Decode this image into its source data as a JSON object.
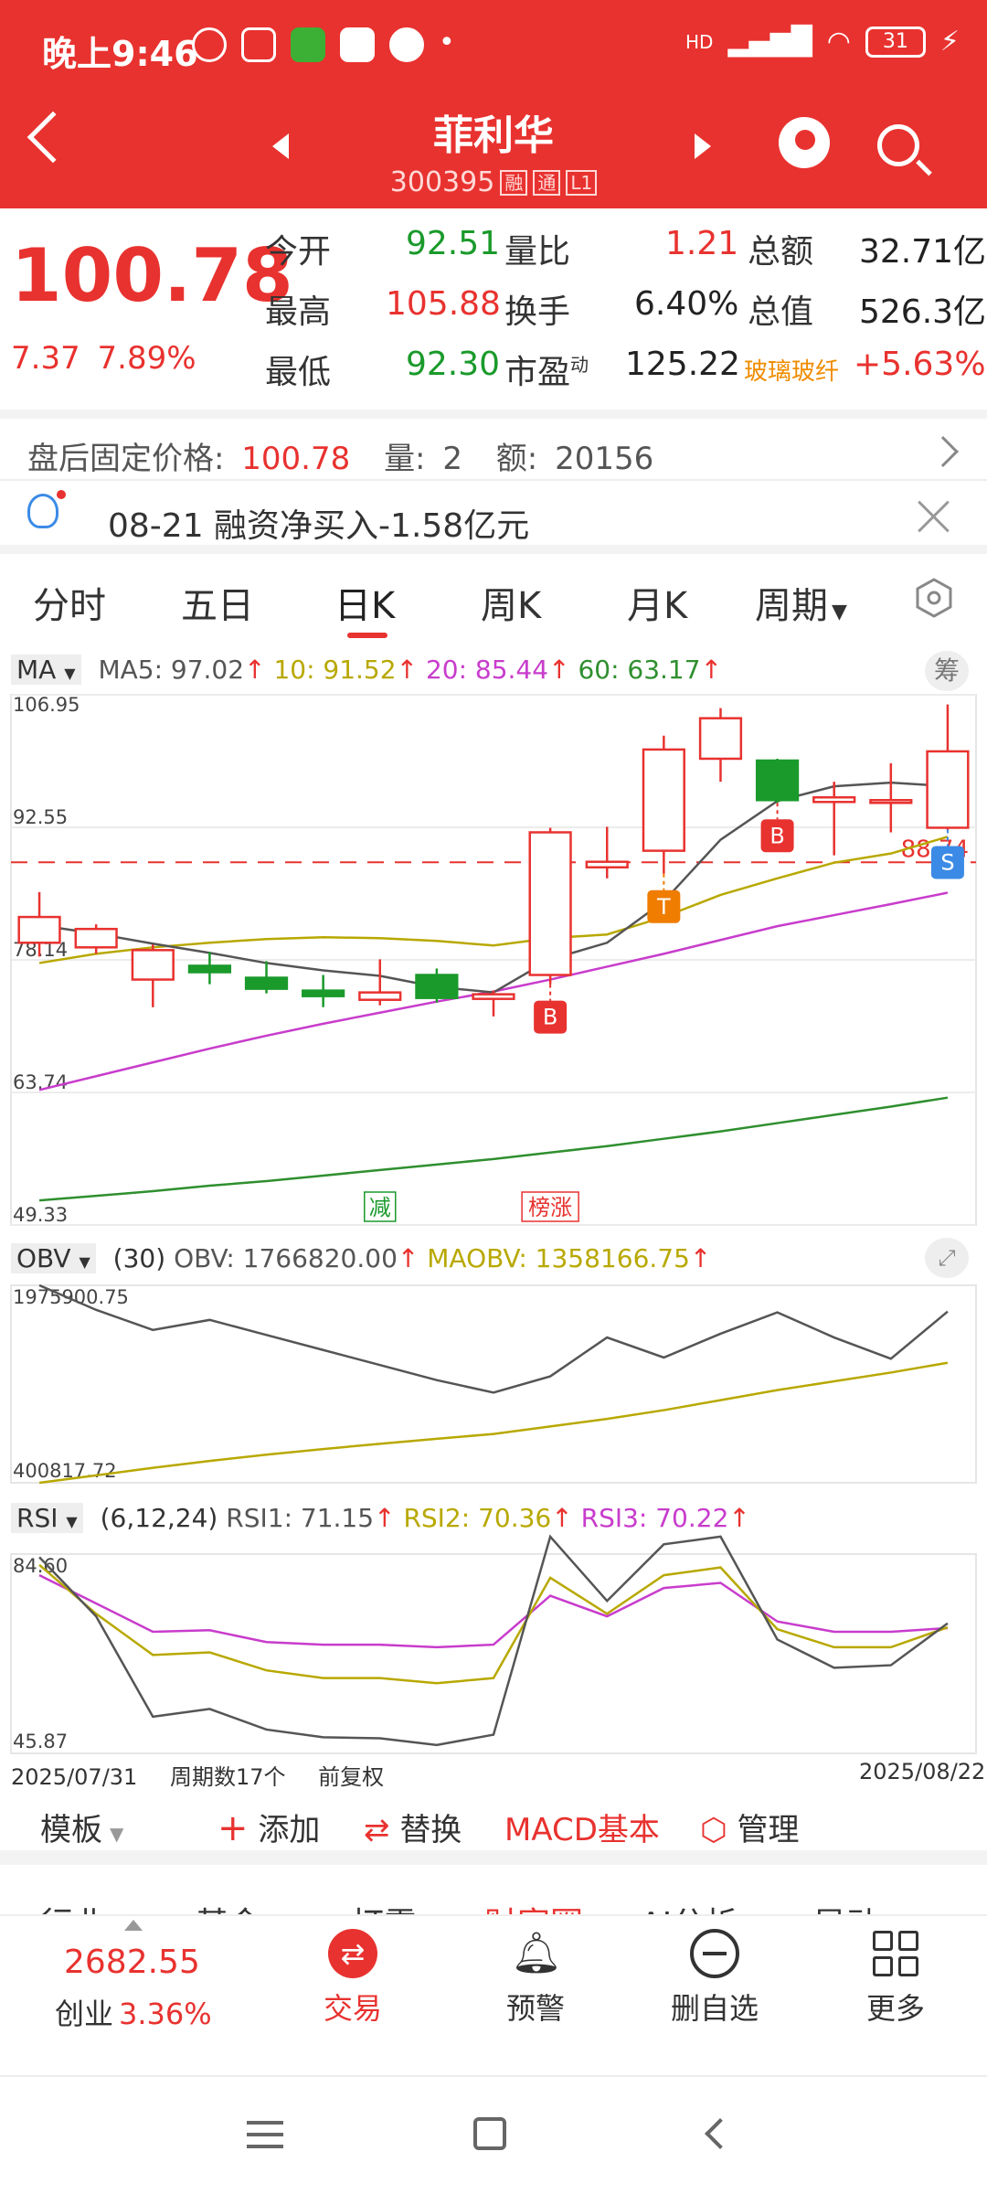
{
  "status_bar": {
    "time": "晚上9:46",
    "network": "HD",
    "battery": "31"
  },
  "header": {
    "stock_name": "菲利华",
    "stock_code": "300395",
    "tags": [
      "融",
      "通",
      "L1"
    ]
  },
  "quote": {
    "price": "100.78",
    "change": "7.37",
    "change_pct": "7.89%",
    "fields": [
      {
        "label": "今开",
        "value": "92.51",
        "color": "#1a9a2b"
      },
      {
        "label": "量比",
        "value": "1.21",
        "color": "#e8322f"
      },
      {
        "label": "总额",
        "value": "32.71亿",
        "color": "#222222"
      },
      {
        "label": "最高",
        "value": "105.88",
        "color": "#e8322f"
      },
      {
        "label": "换手",
        "value": "6.40%",
        "color": "#222222"
      },
      {
        "label": "总值",
        "value": "526.3亿",
        "color": "#222222"
      },
      {
        "label": "最低",
        "value": "92.30",
        "color": "#1a9a2b"
      },
      {
        "label": "市盈",
        "value": "125.22",
        "color": "#222222"
      }
    ],
    "pe_superscript": "动",
    "sector_name": "玻璃玻纤",
    "sector_change": "+5.63%"
  },
  "after_hours": {
    "label": "盘后固定价格:",
    "price": "100.78",
    "vol_label": "量:",
    "vol": "2",
    "amt_label": "额:",
    "amt": "20156"
  },
  "notice": {
    "text": "08-21 融资净买入-1.58亿元"
  },
  "tabs": [
    "分时",
    "五日",
    "日K",
    "周K",
    "月K",
    "周期"
  ],
  "active_tab": "日K",
  "colors": {
    "up": "#e8322f",
    "down": "#1a9a2b",
    "ma5": "#555555",
    "ma10": "#b8a800",
    "ma20": "#c83ccc",
    "ma60": "#2f8f2f"
  },
  "ma_indicator": {
    "name": "MA",
    "ma5": "MA5: 97.02",
    "ma10": "10: 91.52",
    "ma20": "20: 85.44",
    "ma60": "60: 63.17",
    "chip_btn": "筹"
  },
  "obv_indicator": {
    "name": "OBV",
    "param": "(30)",
    "obv": "OBV: 1766820.00",
    "maobv": "MAOBV: 1358166.75"
  },
  "rsi_indicator": {
    "name": "RSI",
    "param": "(6,12,24)",
    "rsi1": "RSI1: 71.15",
    "rsi2": "RSI2: 70.36",
    "rsi3": "RSI3: 70.22"
  },
  "chart_data": [
    {
      "type": "candlestick",
      "ylim": [
        49.33,
        106.95
      ],
      "y_ticks": [
        "106.95",
        "92.55",
        "78.14",
        "63.74",
        "49.33"
      ],
      "reference_line": "88.74",
      "candles": [
        {
          "o": 80.0,
          "h": 85.5,
          "l": 78.5,
          "c": 82.8
        },
        {
          "o": 79.5,
          "h": 82.0,
          "l": 78.8,
          "c": 81.5
        },
        {
          "o": 76.0,
          "h": 79.8,
          "l": 73.0,
          "c": 79.2
        },
        {
          "o": 77.5,
          "h": 79.0,
          "l": 75.5,
          "c": 76.8
        },
        {
          "o": 76.2,
          "h": 78.0,
          "l": 74.5,
          "c": 75.0
        },
        {
          "o": 74.8,
          "h": 76.5,
          "l": 73.0,
          "c": 74.2
        },
        {
          "o": 73.8,
          "h": 78.2,
          "l": 73.2,
          "c": 74.6
        },
        {
          "o": 76.5,
          "h": 77.2,
          "l": 73.5,
          "c": 74.0
        },
        {
          "o": 73.9,
          "h": 74.8,
          "l": 72.0,
          "c": 74.4
        },
        {
          "o": 76.5,
          "h": 92.5,
          "l": 75.5,
          "c": 92.0
        },
        {
          "o": 88.2,
          "h": 92.6,
          "l": 87.0,
          "c": 88.8
        },
        {
          "o": 90.0,
          "h": 102.5,
          "l": 87.5,
          "c": 101.0
        },
        {
          "o": 100.0,
          "h": 105.5,
          "l": 97.5,
          "c": 104.4
        },
        {
          "o": 99.8,
          "h": 100.0,
          "l": 95.2,
          "c": 95.5
        },
        {
          "o": 95.3,
          "h": 97.5,
          "l": 89.5,
          "c": 95.8
        },
        {
          "o": 95.2,
          "h": 99.5,
          "l": 92.0,
          "c": 95.5
        },
        {
          "o": 92.5,
          "h": 105.9,
          "l": 92.3,
          "c": 100.8
        }
      ],
      "ma5": [
        81.9,
        81.0,
        79.9,
        78.9,
        77.8,
        77.0,
        76.4,
        75.2,
        74.6,
        78.2,
        80.0,
        84.5,
        91.2,
        95.4,
        97.0,
        97.4,
        97.02
      ],
      "ma10": [
        77.8,
        78.8,
        79.5,
        80.0,
        80.4,
        80.6,
        80.5,
        80.2,
        79.7,
        80.5,
        80.9,
        82.8,
        85.2,
        87.0,
        88.7,
        89.7,
        91.52
      ],
      "ma20": [
        64.0,
        65.5,
        67.0,
        68.5,
        69.9,
        71.2,
        72.4,
        73.6,
        74.7,
        76.0,
        77.4,
        78.8,
        80.3,
        81.8,
        83.0,
        84.2,
        85.44
      ],
      "ma60": [
        52.0,
        52.5,
        53.0,
        53.6,
        54.1,
        54.7,
        55.3,
        55.9,
        56.5,
        57.2,
        57.9,
        58.7,
        59.5,
        60.4,
        61.3,
        62.2,
        63.17
      ],
      "signals": [
        {
          "index": 9,
          "label": "B",
          "pos": "below"
        },
        {
          "index": 11,
          "label": "T",
          "pos": "below"
        },
        {
          "index": 13,
          "label": "B",
          "pos": "below"
        },
        {
          "index": 16,
          "label": "S",
          "pos": "below"
        }
      ],
      "event_tags": [
        {
          "index": 6,
          "label": "减",
          "color": "#1a9a2b"
        },
        {
          "index": 9,
          "label": "榜涨",
          "color": "#e8322f"
        }
      ]
    },
    {
      "type": "line",
      "name": "OBV",
      "ylim": [
        400817.72,
        1975900.75
      ],
      "y_ticks": [
        "1975900.75",
        "400817.72"
      ],
      "obv": [
        1975900,
        1780000,
        1620000,
        1700000,
        1580000,
        1460000,
        1340000,
        1220000,
        1120000,
        1250000,
        1560000,
        1400000,
        1590000,
        1760000,
        1560000,
        1390000,
        1766820
      ],
      "maobv": [
        400817,
        460000,
        520000,
        575000,
        625000,
        670000,
        712000,
        752000,
        790000,
        850000,
        910000,
        980000,
        1060000,
        1140000,
        1210000,
        1280000,
        1358166
      ]
    },
    {
      "type": "line",
      "name": "RSI",
      "ylim": [
        45.87,
        84.6
      ],
      "y_ticks": [
        "84.60",
        "45.87"
      ],
      "rsi1": [
        84.0,
        72.5,
        53.0,
        54.5,
        50.5,
        49.0,
        48.8,
        47.5,
        49.5,
        88.0,
        75.5,
        86.5,
        88.0,
        68.0,
        62.5,
        63.0,
        71.15
      ],
      "rsi2": [
        82.5,
        73.0,
        65.0,
        65.5,
        62.0,
        60.5,
        60.5,
        59.5,
        60.5,
        80.0,
        73.0,
        80.5,
        82.0,
        70.0,
        66.5,
        66.5,
        70.36
      ],
      "rsi3": [
        80.5,
        75.0,
        69.5,
        69.8,
        67.5,
        67.0,
        67.0,
        66.5,
        67.0,
        76.5,
        72.5,
        78.0,
        79.0,
        71.5,
        69.5,
        69.5,
        70.22
      ],
      "x_start": "2025/07/31",
      "x_end": "2025/08/22"
    }
  ],
  "chart_footer": {
    "period_count": "周期数17个",
    "adjust": "前复权"
  },
  "toolbar": {
    "template": "模板",
    "add": "添加",
    "replace": "替换",
    "macd": "MACD基本",
    "manage": "管理"
  },
  "subtabs": [
    "行业",
    "基金",
    "打雷",
    "财富圈",
    "AI分析",
    "异动"
  ],
  "bottom_nav": {
    "index_value": "2682.55",
    "index_name": "创业",
    "index_change": "3.36%",
    "items": [
      "交易",
      "预警",
      "删自选",
      "更多"
    ]
  }
}
